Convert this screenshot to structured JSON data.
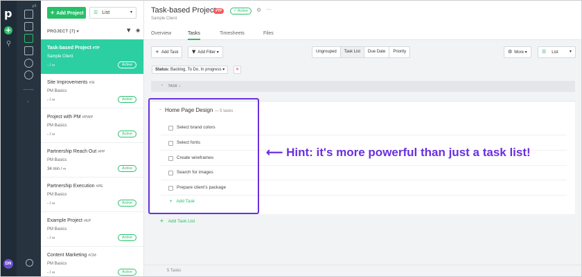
{
  "sidebar": {
    "logo": "p",
    "plus": "+",
    "avatar_initials": "DN"
  },
  "project_list": {
    "add_label": "Add Project",
    "view_label": "List",
    "header": "PROJECT (7) ▾",
    "items": [
      {
        "name": "Task-based Project",
        "code": "#TP",
        "client": "Sample Client",
        "time": "- / ∞",
        "status": "Active"
      },
      {
        "name": "Site Improvements",
        "code": "#SI",
        "client": "PM Basics",
        "time": "- / ∞",
        "status": "Active"
      },
      {
        "name": "Project with PM",
        "code": "#PWP",
        "client": "PM Basics",
        "time": "- / ∞",
        "status": "Active"
      },
      {
        "name": "Partnership Reach Out",
        "code": "#PP",
        "client": "PM Basics",
        "time": "34 min / ∞",
        "status": "Active"
      },
      {
        "name": "Partnership Execution",
        "code": "#PE",
        "client": "PM Basics",
        "time": "- / ∞",
        "status": "Active"
      },
      {
        "name": "Example Project",
        "code": "#EP",
        "client": "PM Basics",
        "time": "- / ∞",
        "status": "Active"
      },
      {
        "name": "Content Marketing",
        "code": "#CM",
        "client": "PM Basics",
        "time": "- / ∞",
        "status": "Active"
      }
    ]
  },
  "header": {
    "title": "Task-based Project",
    "tag": "#TP",
    "status": "✓ Active",
    "client": "Sample Client",
    "tabs": [
      "Overview",
      "Tasks",
      "Timesheets",
      "Files"
    ],
    "active_tab": "Tasks"
  },
  "toolbar": {
    "add_task": "Add Task",
    "add_filter": "Add Filter ▾",
    "group_options": [
      "Ungrouped",
      "Task List",
      "Due Date",
      "Priority"
    ],
    "active_group": "Task List",
    "more": "More ▾",
    "view": "List"
  },
  "filter_chip": {
    "label": "Status:",
    "value": "Backlog, To Do, In progress ▾"
  },
  "task_header": "TASK ↕",
  "task_list": {
    "name": "Home Page Design",
    "count": "— 5 tasks",
    "tasks": [
      "Select brand colors",
      "Select fonts",
      "Create wireframes",
      "Search for images",
      "Prepare client’s package"
    ],
    "add_task": "Add Task"
  },
  "add_task_list": "Add Task List",
  "footer": "5 Tasks",
  "hint": "⟵ Hint: it's more powerful than just a task list!",
  "colors": {
    "accent": "#27c06a",
    "selected_project": "#2ccfa2",
    "hint": "#6a2fe0",
    "tag": "#ef5a5a"
  }
}
